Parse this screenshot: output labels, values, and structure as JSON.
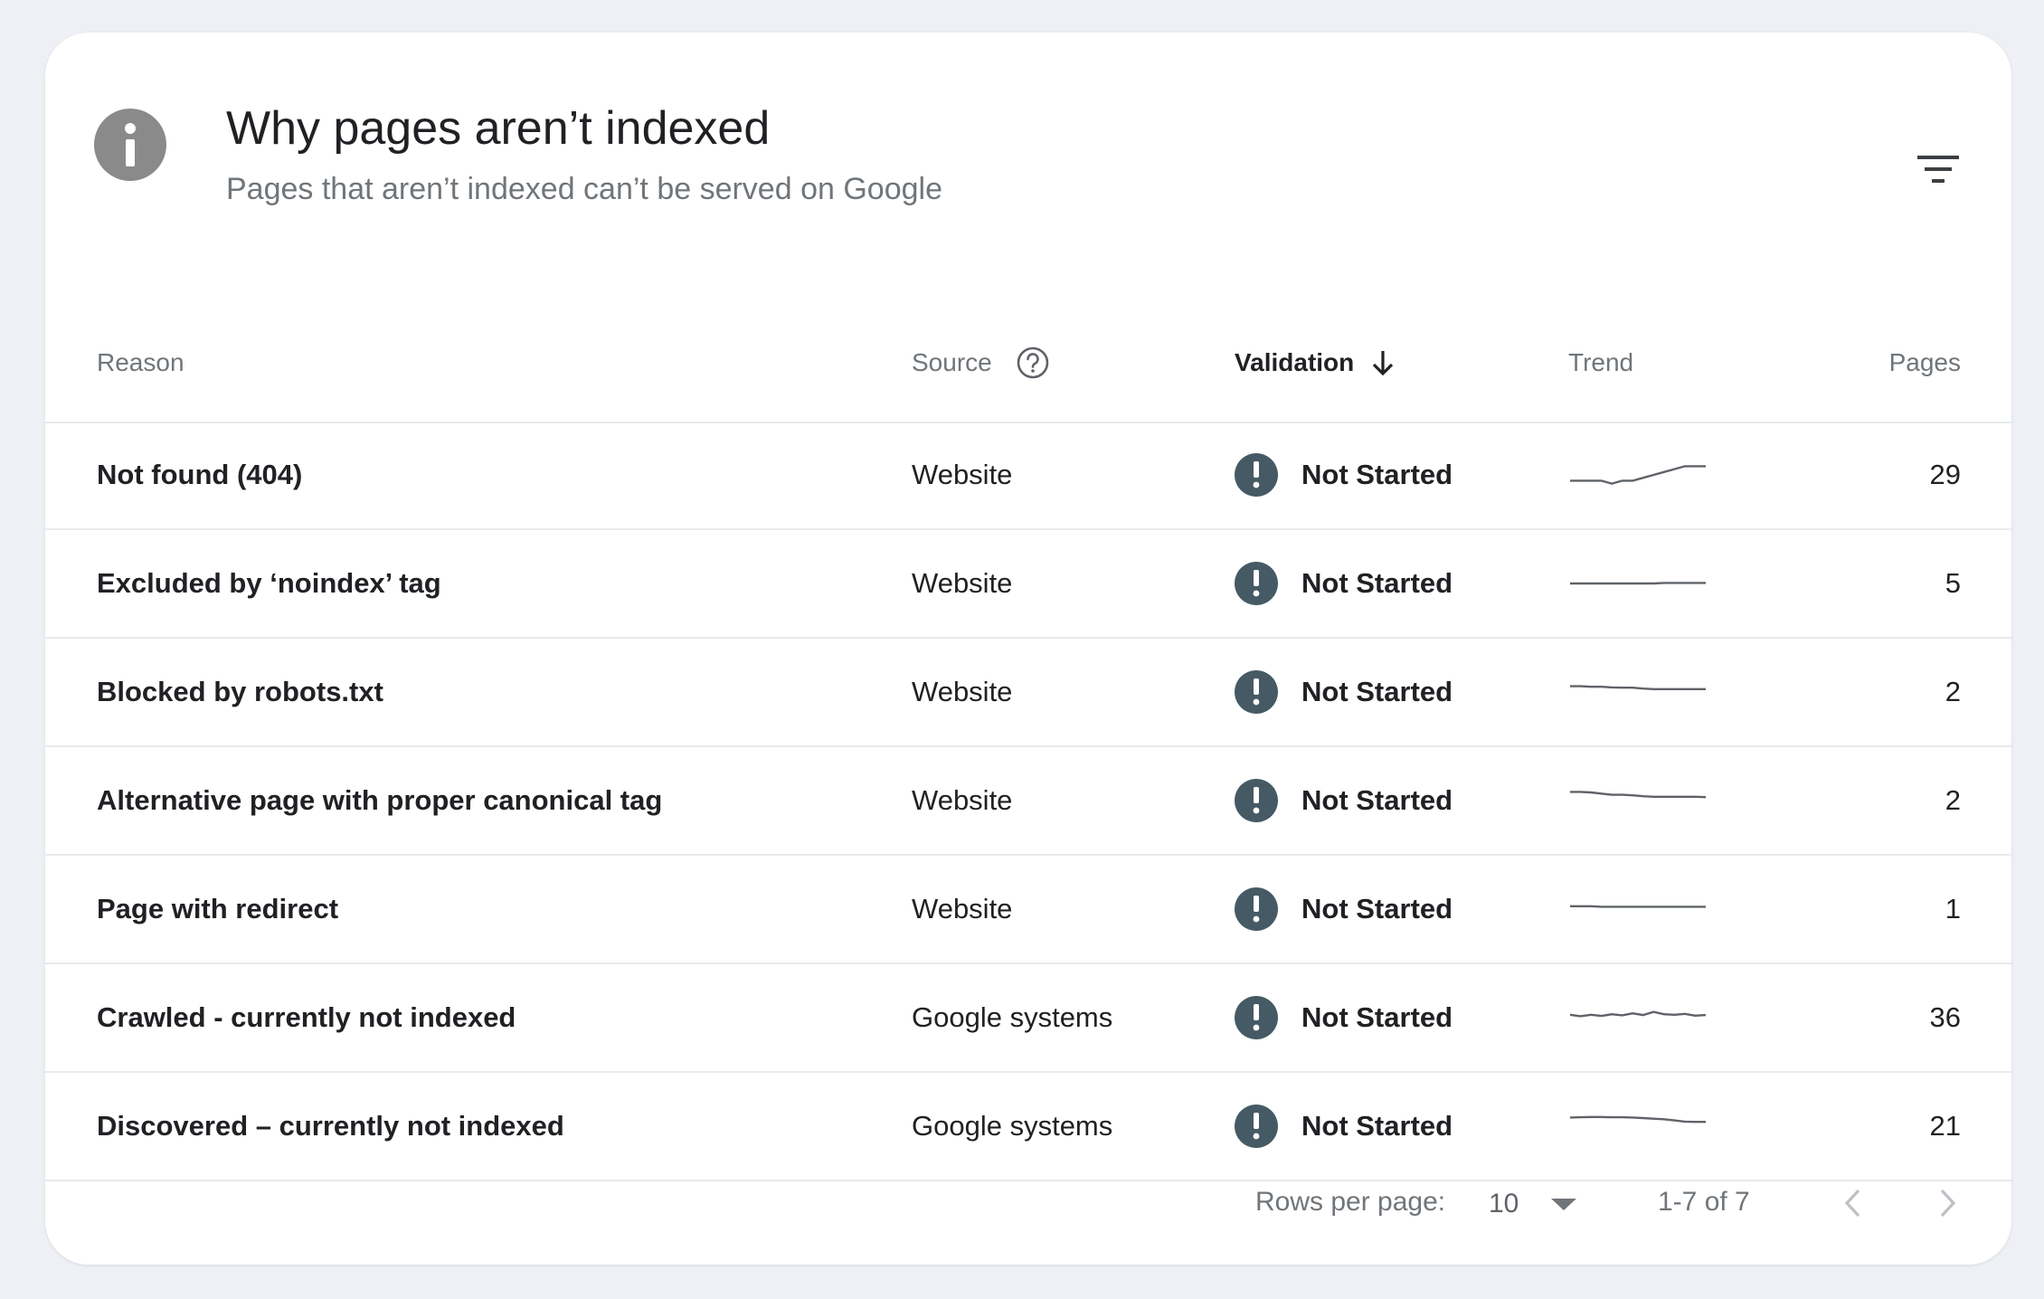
{
  "header": {
    "title": "Why pages aren’t indexed",
    "subtitle": "Pages that aren’t indexed can’t be served on Google",
    "info_icon": "info-icon",
    "filter_icon": "filter-icon"
  },
  "columns": {
    "reason": "Reason",
    "source": "Source",
    "validation": "Validation",
    "trend": "Trend",
    "pages": "Pages"
  },
  "rows": [
    {
      "reason": "Not found (404)",
      "source": "Website",
      "validation": "Not Started",
      "pages": "29",
      "trend": [
        3,
        3,
        3,
        3,
        2,
        3,
        3,
        4,
        5,
        6,
        7,
        8,
        8,
        8
      ]
    },
    {
      "reason": "Excluded by ‘noindex’ tag",
      "source": "Website",
      "validation": "Not Started",
      "pages": "5",
      "trend": [
        5,
        5,
        5,
        5,
        5,
        5,
        5,
        5,
        5,
        5.2,
        5.2,
        5.2,
        5.2,
        5.2
      ]
    },
    {
      "reason": "Blocked by robots.txt",
      "source": "Website",
      "validation": "Not Started",
      "pages": "2",
      "trend": [
        7,
        7,
        6.8,
        6.8,
        6.6,
        6.5,
        6.5,
        6.2,
        6,
        6,
        6,
        6,
        6,
        6
      ]
    },
    {
      "reason": "Alternative page with proper canonical tag",
      "source": "Website",
      "validation": "Not Started",
      "pages": "2",
      "trend": [
        8,
        8,
        7.8,
        7.4,
        7,
        7,
        6.8,
        6.5,
        6.3,
        6.3,
        6.3,
        6.3,
        6.3,
        6.2
      ]
    },
    {
      "reason": "Page with redirect",
      "source": "Website",
      "validation": "Not Started",
      "pages": "1",
      "trend": [
        6,
        6,
        6,
        5.8,
        5.8,
        5.8,
        5.8,
        5.8,
        5.8,
        5.8,
        5.8,
        5.8,
        5.8,
        5.8
      ]
    },
    {
      "reason": "Crawled - currently not indexed",
      "source": "Google systems",
      "validation": "Not Started",
      "pages": "36",
      "trend": [
        6,
        5.5,
        6,
        5.6,
        6.2,
        5.8,
        6.5,
        5.9,
        7,
        6.2,
        6,
        6.3,
        5.7,
        5.9
      ]
    },
    {
      "reason": "Discovered – currently not indexed",
      "source": "Google systems",
      "validation": "Not Started",
      "pages": "21",
      "trend": [
        8,
        8.1,
        8.2,
        8.2,
        8.1,
        8.1,
        8,
        7.8,
        7.6,
        7.4,
        7,
        6.6,
        6.5,
        6.5
      ]
    }
  ],
  "footer": {
    "rows_per_page_label": "Rows per page:",
    "rows_per_page_value": "10",
    "range": "1-7 of 7"
  }
}
